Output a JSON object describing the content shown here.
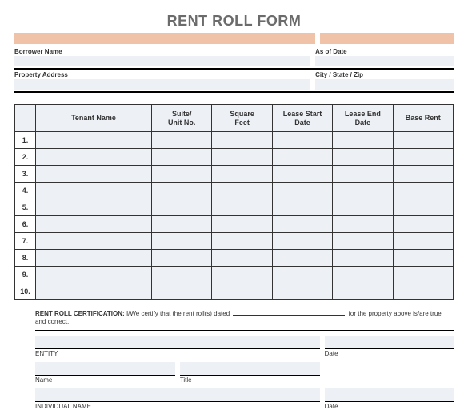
{
  "title": "RENT ROLL FORM",
  "meta": {
    "borrower_label": "Borrower Name",
    "as_of_label": "As of Date",
    "property_label": "Property Address",
    "city_label": "City / State / Zip"
  },
  "table": {
    "headers": {
      "tenant": "Tenant Name",
      "suite": "Suite/\nUnit No.",
      "sqft": "Square\nFeet",
      "start": "Lease Start\nDate",
      "end": "Lease End\nDate",
      "rent": "Base Rent"
    },
    "rows": [
      "1.",
      "2.",
      "3.",
      "4.",
      "5.",
      "6.",
      "7.",
      "8.",
      "9.",
      "10."
    ]
  },
  "cert": {
    "label": "RENT ROLL CERTIFICATION:",
    "text_a": "I/We certify that the rent roll(s) dated",
    "text_b": "for the property above is/are true and correct."
  },
  "sig": {
    "entity": "ENTITY",
    "date": "Date",
    "name": "Name",
    "title": "Title",
    "individual": "INDIVIDUAL NAME"
  }
}
